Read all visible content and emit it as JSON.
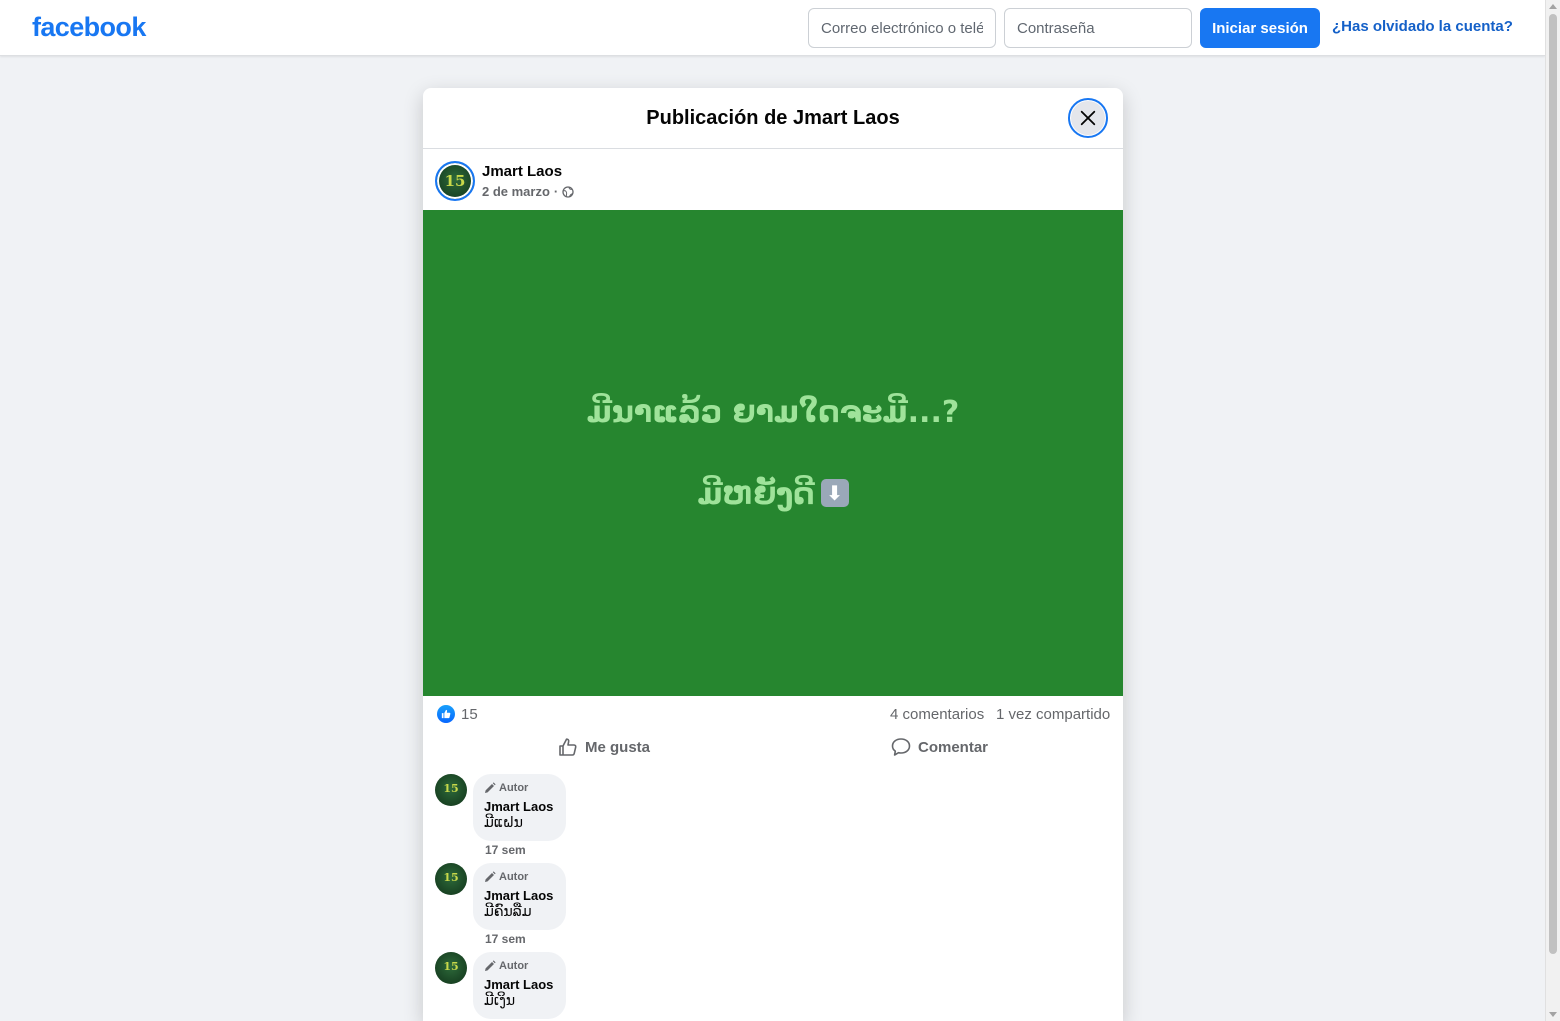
{
  "header": {
    "logo": "facebook",
    "email_placeholder": "Correo electrónico o teléfono",
    "password_placeholder": "Contraseña",
    "login_label": "Iniciar sesión",
    "forgot_label": "¿Has olvidado la cuenta?"
  },
  "modal": {
    "title": "Publicación de Jmart Laos",
    "close_icon": "close-icon"
  },
  "post": {
    "author": "Jmart Laos",
    "date": "2 de marzo",
    "separator": "·",
    "privacy_icon": "globe-icon",
    "image_bg": "#26862f",
    "image_text_line1": "ມີນາແລ້ວ ຍາມໃດຈະມີ...?",
    "image_text_line2": "ມີຫຍັງດີ",
    "image_emoji": "down-arrow-emoji",
    "likes": "15",
    "comments_count": "4 comentarios",
    "shares_count": "1 vez compartido",
    "like_action": "Me gusta",
    "comment_action": "Comentar"
  },
  "comments": [
    {
      "badge": "Autor",
      "name": "Jmart Laos",
      "text": "ມີແຝນ",
      "time": "17 sem"
    },
    {
      "badge": "Autor",
      "name": "Jmart Laos",
      "text": "ມີຄົນລືມ",
      "time": "17 sem"
    },
    {
      "badge": "Autor",
      "name": "Jmart Laos",
      "text": "ມີເງິນ",
      "time": ""
    }
  ],
  "colors": {
    "brand": "#1877f2",
    "post_text": "#9fe39a"
  }
}
